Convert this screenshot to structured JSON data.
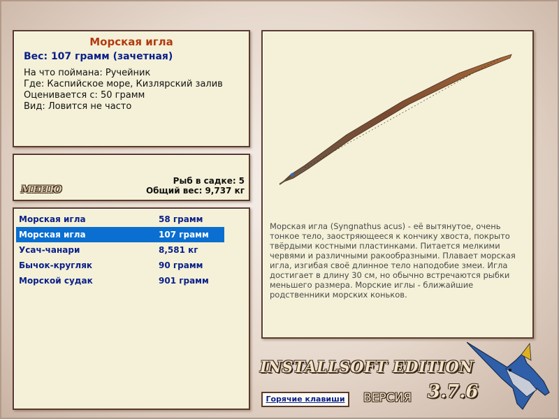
{
  "fish": {
    "title": "Морская игла",
    "weight_line": "Вес: 107 грамм (зачетная)",
    "details": [
      "На что поймана: Ручейник",
      "Где: Каспийское море, Кизлярский залив",
      "Оценивается с: 50 грамм",
      "Вид: Ловится не часто"
    ],
    "description": "Морская игла (Syngnathus acus) - её вытянутое, очень тонкое тело, заостряющееся к кончику хвоста, покрыто твёрдыми костными пластинками. Питается мелкими червями и различными ракообразными. Плавает морская игла, изгибая своё длинное тело наподобие змеи. Игла достигает в длину 30 см, но обычно встречаются рыбки меньшего размера. Морские иглы - ближайшие родственники морских коньков."
  },
  "stats": {
    "menu_label": "МЕНЮ",
    "fish_count_label": "Рыб в садке:",
    "fish_count": "5",
    "total_weight_label": "Общий вес:",
    "total_weight": "9,737 кг"
  },
  "catch_list": [
    {
      "name": "Морская игла",
      "weight": "58 грамм",
      "selected": false
    },
    {
      "name": "Морская игла",
      "weight": "107 грамм",
      "selected": true
    },
    {
      "name": "Усач-чанари",
      "weight": "8,581 кг",
      "selected": false
    },
    {
      "name": "Бычок-кругляк",
      "weight": "90 грамм",
      "selected": false
    },
    {
      "name": "Морской судак",
      "weight": "901 грамм",
      "selected": false
    }
  ],
  "footer": {
    "edition": "INSTALLSOFT EDITION",
    "hotkeys_label": "Горячие клавиши",
    "version_label": "ВЕРСИЯ",
    "version": "3.7.6"
  },
  "colors": {
    "panel_bg": "#f4f1d8",
    "panel_border": "#5a3a2a",
    "title_red": "#b33a10",
    "text_blue": "#0a1f8a",
    "selection_blue": "#0a6fd0"
  }
}
